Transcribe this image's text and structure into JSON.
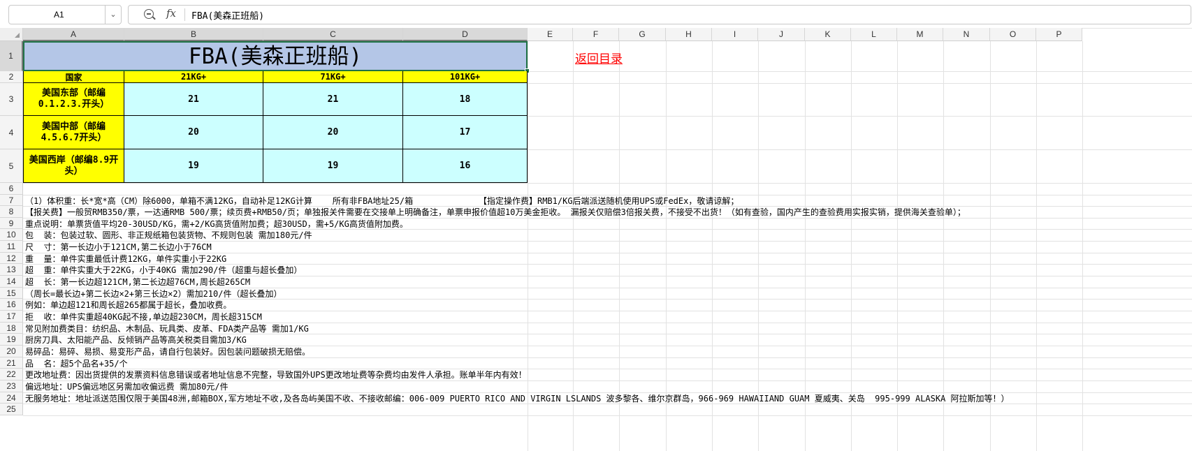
{
  "formula_bar": {
    "name_box": "A1",
    "fx_label": "fx",
    "formula": "FBA(美森正班船)"
  },
  "columns": [
    "A",
    "B",
    "C",
    "D",
    "E",
    "F",
    "G",
    "H",
    "I",
    "J",
    "K",
    "L",
    "M",
    "N",
    "O",
    "P"
  ],
  "rows": [
    "1",
    "2",
    "3",
    "4",
    "5",
    "6",
    "7",
    "8",
    "9",
    "10",
    "11",
    "12",
    "13",
    "14",
    "15",
    "16",
    "17",
    "18",
    "19",
    "20",
    "21",
    "22",
    "23",
    "24",
    "25"
  ],
  "sheet": {
    "title": "FBA(美森正班船)",
    "back_link": "返回目录",
    "table_headers": [
      "国家",
      "21KG+",
      "71KG+",
      "101KG+"
    ],
    "table_rows": [
      {
        "region": "美国东部（邮编0.1.2.3.开头）",
        "values": [
          "21",
          "21",
          "18"
        ]
      },
      {
        "region": "美国中部（邮编4.5.6.7开头）",
        "values": [
          "20",
          "20",
          "17"
        ]
      },
      {
        "region": "美国西岸（邮编8.9开头）",
        "values": [
          "19",
          "19",
          "16"
        ]
      }
    ],
    "notes": [
      "（1）体积重：长*宽*高（CM）除6000，单箱不满12KG，自动补足12KG计算    所有非FBA地址25/箱             【指定操作费】RMB1/KG后端派送随机使用UPS或FedEx，敬请谅解；",
      "【报关费】一般贸RMB350/票，一达通RMB 500/票；续页费+RMB50/页；单独报关件需要在交接单上明确备注，单票申报价值超10万美金拒收。 漏报关仅赔偿3倍报关费，不接受不出货！（如有查验，国内产生的查验费用实报实销，提供海关查验单）；",
      "重点说明：单票货值平均20-30USD/KG，需+2/KG高货值附加费；超30USD，需+5/KG高货值附加费。",
      "包  装：包装过软、圆形、非正规纸箱包装货物、不规则包装 需加180元/件",
      "尺  寸：第一长边小于121CM,第二长边小于76CM",
      "重  量：单件实重最低计费12KG，单件实重小于22KG",
      "超  重：单件实重大于22KG，小于40KG 需加290/件（超重与超长叠加）",
      "超  长：第一长边超121CM,第二长边超76CM,周长超265CM",
      "（周长=最长边+第二长边×2+第三长边×2）需加210/件（超长叠加）",
      "例如：单边超121和周长超265都属于超长，叠加收费。",
      "拒  收：单件实重超40KG起不接,单边超230CM，周长超315CM",
      "常见附加费类目：纺织品、木制品、玩具类、皮革、FDA类产品等 需加1/KG",
      "厨房刀具、太阳能产品、反倾销产品等高关税类目需加3/KG",
      "易碎品：易碎、易损、易变形产品，请自行包装好。因包装问题破损无赔偿。",
      "品  名：超5个品名+35/个",
      "更改地址费：因出货提供的发票资料信息错误或者地址信息不完整，导致国外UPS更改地址费等杂费均由发件人承担。账单半年内有效！",
      "偏远地址：UPS偏远地区另需加收偏远费 需加80元/件",
      "无服务地址：地址派送范围仅限于美国48洲,邮箱BOX,军方地址不收,及各岛屿美国不收、不接收邮编：006-009 PUERTO RICO AND VIRGIN LSLANDS 波多黎各、维尔京群岛，966-969 HAWAIIAND GUAM 夏威夷、关岛  995-999 ALASKA 阿拉斯加等！）"
    ]
  }
}
